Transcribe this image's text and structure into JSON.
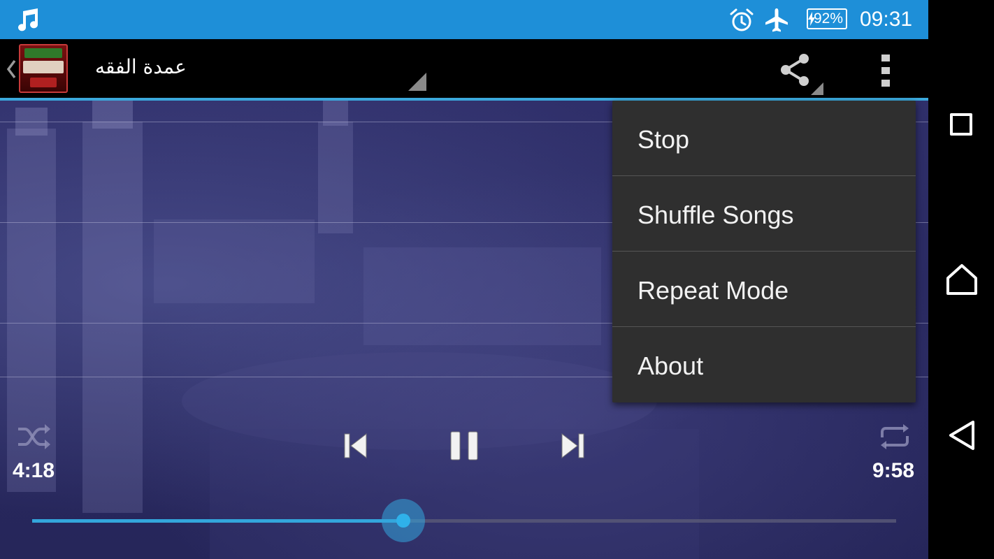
{
  "status_bar": {
    "icons": [
      "music-note-icon",
      "alarm-clock-icon",
      "airplane-mode-icon",
      "battery-charging-icon"
    ],
    "battery_percent": "92%",
    "time": "09:31",
    "background_color": "#1e8fd8"
  },
  "action_bar": {
    "title": "عمدة الفقه",
    "icons": [
      "up-chevron-icon",
      "app-icon",
      "share-icon",
      "overflow-menu-icon"
    ],
    "accent_color": "#3ba8dc"
  },
  "overflow_menu": {
    "items": [
      {
        "label": "Stop"
      },
      {
        "label": "Shuffle Songs"
      },
      {
        "label": "Repeat Mode"
      },
      {
        "label": "About"
      }
    ]
  },
  "player": {
    "elapsed": "4:18",
    "total": "9:58",
    "progress": 0.43,
    "state": "playing",
    "controls": [
      "shuffle-icon",
      "skip-previous-icon",
      "pause-icon",
      "skip-next-icon",
      "repeat-icon"
    ],
    "accent_color": "#33a6dc"
  },
  "nav_bar": {
    "icons": [
      "recent-apps-icon",
      "home-icon",
      "back-icon"
    ]
  }
}
